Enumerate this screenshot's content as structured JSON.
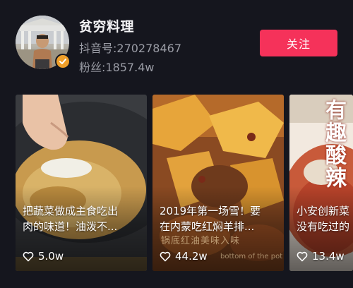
{
  "profile": {
    "name": "贫穷料理",
    "douyin_id": "抖音号:270278467",
    "fans": "粉丝:1857.4w",
    "follow_label": "关注"
  },
  "videos": [
    {
      "caption": "把蔬菜做成主食吃出\n肉的味道！油泼不...",
      "likes": "5.0w"
    },
    {
      "caption": "2019年第一场雪！要\n在内蒙吃红焖羊排...",
      "likes": "44.2w",
      "overlay_text": "锅底红油美味入味",
      "overlay_sub": "bottom of the pot"
    },
    {
      "caption": "小安创新菜\n没有吃过的",
      "likes": "13.4w",
      "vertical_text": "有趣酸辣"
    }
  ],
  "colors": {
    "background": "#15161e",
    "follow_button": "#f5325a",
    "verified_badge": "#f0a02a",
    "meta_text": "#9a9ca5"
  },
  "icons": [
    "verified-badge-icon",
    "heart-icon"
  ]
}
